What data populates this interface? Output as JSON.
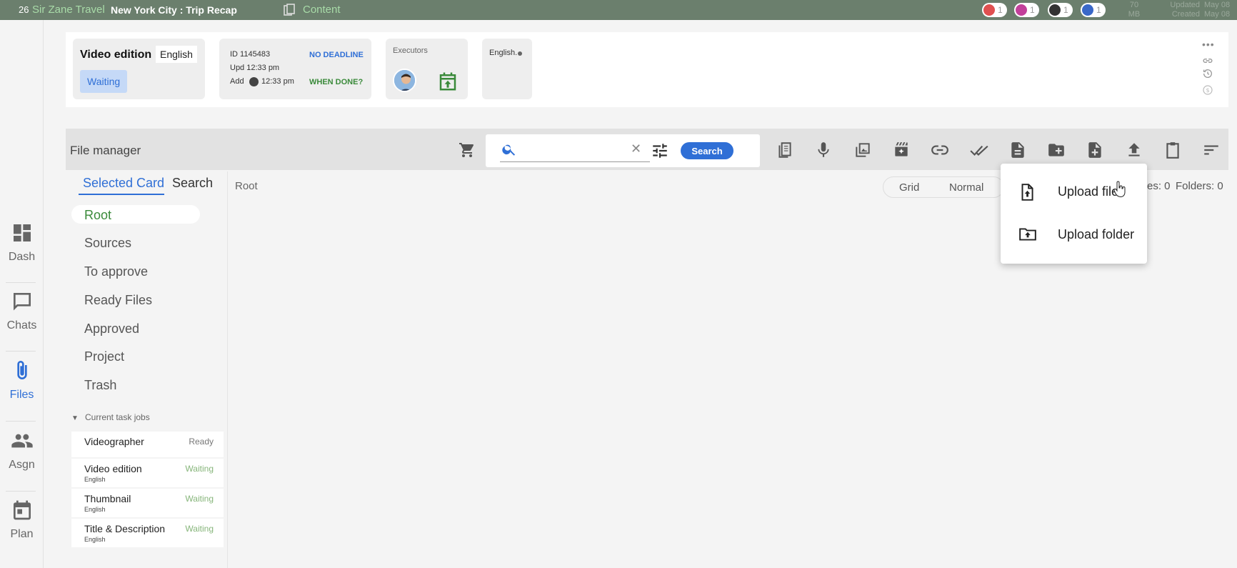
{
  "topbar": {
    "count": "26",
    "client": "Sir Zane Travel",
    "project": "New York City : Trip Recap",
    "section": "Content",
    "socials": [
      {
        "icon": "youtube-icon",
        "count": "1",
        "color": "#e05050"
      },
      {
        "icon": "instagram-icon",
        "count": "1",
        "color": "#c2409a"
      },
      {
        "icon": "tiktok-icon",
        "count": "1",
        "color": "#333333"
      },
      {
        "icon": "facebook-icon",
        "count": "1",
        "color": "#3a68c8"
      }
    ],
    "size_value": "70",
    "size_unit": "MB",
    "updated_label": "Updated",
    "created_label": "Created",
    "updated_date": "May 08",
    "created_date": "May 08"
  },
  "nav": [
    {
      "label": "Dash",
      "icon": "dashboard-icon"
    },
    {
      "label": "Chats",
      "icon": "chat-icon"
    },
    {
      "label": "Files",
      "icon": "paperclip-icon",
      "active": true
    },
    {
      "label": "Asgn",
      "icon": "people-icon"
    },
    {
      "label": "Plan",
      "icon": "calendar-icon"
    }
  ],
  "header": {
    "task_title": "Video edition",
    "language": "English",
    "status": "Waiting",
    "id_line": "ID 1145483",
    "upd_line": "Upd 12:33 pm",
    "add_label": "Add",
    "add_time": "12:33 pm",
    "deadline": "NO DEADLINE",
    "when_done": "WHEN DONE?",
    "executors_label": "Executors",
    "lang_card": "English."
  },
  "file_manager": {
    "title": "File manager",
    "search_value": "",
    "search_button": "Search",
    "tabs": [
      "Selected Card",
      "Search"
    ],
    "breadcrumb": "Root",
    "view_modes": [
      "Grid",
      "Normal"
    ],
    "files_count": "es: 0",
    "folders_count": "Folders: 0",
    "folders": [
      "Root",
      "Sources",
      "To approve",
      "Ready Files",
      "Approved",
      "Project",
      "Trash"
    ],
    "jobs_header": "Current task jobs",
    "jobs": [
      {
        "name": "Videographer",
        "lang": "",
        "status": "Ready"
      },
      {
        "name": "Video edition",
        "lang": "English",
        "status": "Waiting"
      },
      {
        "name": "Thumbnail",
        "lang": "English",
        "status": "Waiting"
      },
      {
        "name": "Title & Description",
        "lang": "English",
        "status": "Waiting"
      }
    ]
  },
  "upload_menu": {
    "items": [
      "Upload file",
      "Upload folder"
    ]
  },
  "colors": {
    "accent_green": "#3a8a3a",
    "accent_blue": "#2f6fd6",
    "waiting_green": "#86b57a"
  }
}
